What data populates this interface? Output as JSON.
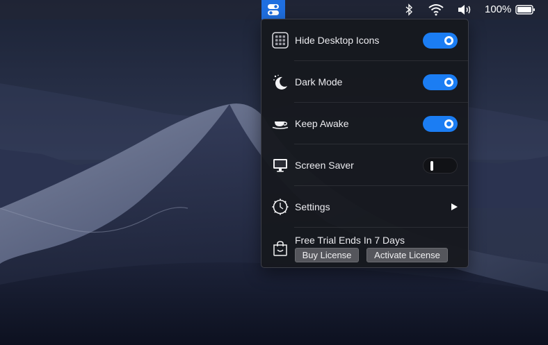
{
  "menubar": {
    "battery_percent": "100%",
    "icons": [
      "app-toggle-icon",
      "bluetooth-icon",
      "wifi-icon",
      "volume-icon",
      "battery-icon"
    ],
    "app_button_color": "#1f6fe0"
  },
  "panel": {
    "items": [
      {
        "label": "Hide Desktop Icons",
        "icon": "grid-icon",
        "toggle": true
      },
      {
        "label": "Dark Mode",
        "icon": "moon-icon",
        "toggle": true
      },
      {
        "label": "Keep Awake",
        "icon": "coffee-cup-icon",
        "toggle": true
      },
      {
        "label": "Screen Saver",
        "icon": "monitor-icon",
        "toggle": false
      },
      {
        "label": "Settings",
        "icon": "gear-icon",
        "submenu": true
      }
    ],
    "trial": {
      "title": "Free Trial Ends In 7 Days",
      "buy_label": "Buy License",
      "activate_label": "Activate License",
      "icon": "shopping-bag-icon"
    },
    "accent_color": "#1b7df3"
  }
}
